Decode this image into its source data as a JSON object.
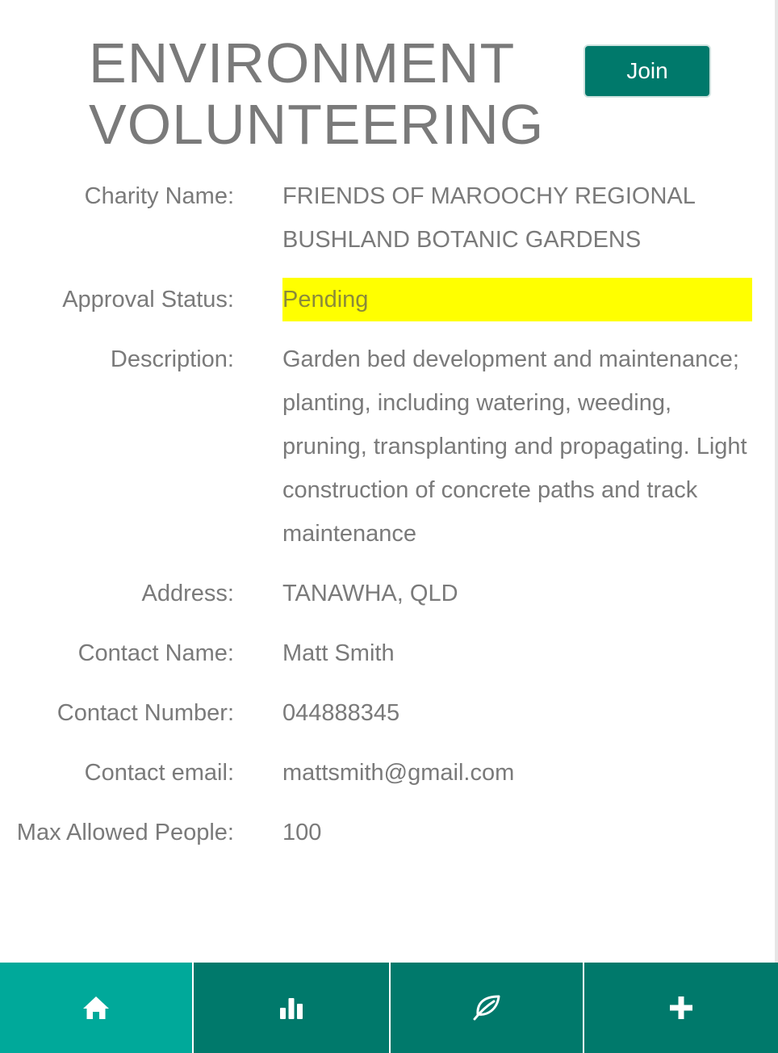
{
  "header": {
    "title_line1": "ENVIRONMENT",
    "title_line2": "VOLUNTEERING",
    "join_label": "Join"
  },
  "details": [
    {
      "label": "Charity Name:",
      "value": "FRIENDS OF MAROOCHY REGIONAL BUSHLAND BOTANIC GARDENS"
    },
    {
      "label": "Approval Status:",
      "value": "Pending",
      "highlight": "#ffff00"
    },
    {
      "label": "Description:",
      "value": "Garden bed development and maintenance; planting, including watering, weeding, pruning, transplanting and propagating. Light construction of concrete paths and track maintenance"
    },
    {
      "label": "Address:",
      "value": "TANAWHA, QLD"
    },
    {
      "label": "Contact Name:",
      "value": "Matt Smith"
    },
    {
      "label": "Contact Number:",
      "value": "044888345"
    },
    {
      "label": "Contact email:",
      "value": "mattsmith@gmail.com"
    },
    {
      "label": "Max Allowed People:",
      "value": "100"
    }
  ],
  "bottom_nav": [
    {
      "icon": "home-icon",
      "active": true
    },
    {
      "icon": "bar-chart-icon",
      "active": false
    },
    {
      "icon": "leaf-icon",
      "active": false
    },
    {
      "icon": "plus-icon",
      "active": false
    }
  ],
  "colors": {
    "primary": "#00796b",
    "active_tab": "#00a99a",
    "text": "#7a7a7a",
    "pending_highlight": "#ffff00"
  }
}
